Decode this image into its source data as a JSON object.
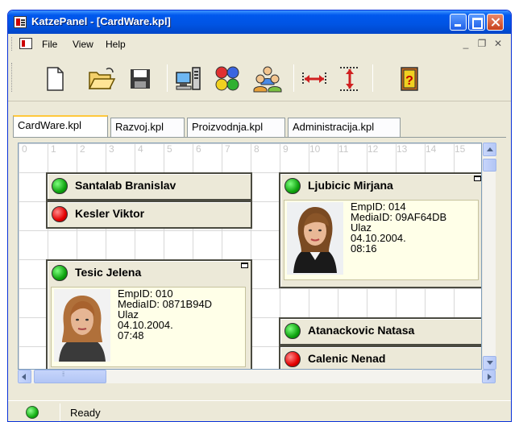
{
  "window": {
    "title": "KatzePanel - [CardWare.kpl]"
  },
  "menu": {
    "file": "File",
    "view": "View",
    "help": "Help"
  },
  "toolbar": {
    "items": [
      "new-icon",
      "open-folder-icon",
      "save-icon",
      "network-computer-icon",
      "colors-icon",
      "users-icon",
      "horizontal-resize-icon",
      "vertical-resize-icon",
      "exit-icon"
    ]
  },
  "tabs": [
    "CardWare.kpl",
    "Razvoj.kpl",
    "Proizvodnja.kpl",
    "Administracija.kpl"
  ],
  "ruler": [
    "0",
    "1",
    "2",
    "3",
    "4",
    "5",
    "6",
    "7",
    "8",
    "9",
    "10",
    "11",
    "12",
    "13",
    "14",
    "15"
  ],
  "cards": {
    "santalab": {
      "name": "Santalab Branislav",
      "status": "green"
    },
    "kesler": {
      "name": "Kesler Viktor",
      "status": "red"
    },
    "ljubicic": {
      "name": "Ljubicic Mirjana",
      "status": "green",
      "empid": "EmpID: 014",
      "mediaid": "MediaID: 09AF64DB",
      "event": "Ulaz",
      "date": "04.10.2004.",
      "time": "08:16"
    },
    "tesic": {
      "name": "Tesic Jelena",
      "status": "green",
      "empid": "EmpID: 010",
      "mediaid": "MediaID: 0871B94D",
      "event": "Ulaz",
      "date": "04.10.2004.",
      "time": "07:48"
    },
    "atanackovic": {
      "name": "Atanackovic Natasa",
      "status": "green"
    },
    "calenic": {
      "name": "Calenic Nenad",
      "status": "red"
    }
  },
  "status": {
    "text": "Ready"
  },
  "colors": {
    "titlebar": "#0054e3",
    "green": "#0fa30f",
    "red": "#e40000",
    "card_bg": "#ece9d8",
    "info_bg": "#ffffe8"
  }
}
